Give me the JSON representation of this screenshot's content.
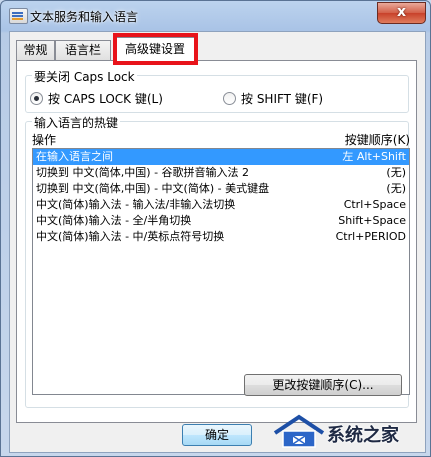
{
  "window": {
    "title": "文本服务和输入语言",
    "close_label": "x"
  },
  "tabs": [
    {
      "label": "常规"
    },
    {
      "label": "语言栏"
    },
    {
      "label": "高级键设置"
    }
  ],
  "caps_lock_group": {
    "title": "要关闭 Caps Lock",
    "options": [
      {
        "label": "按 CAPS LOCK 键(L)",
        "checked": true
      },
      {
        "label": "按 SHIFT 键(F)",
        "checked": false
      }
    ]
  },
  "hotkeys_group": {
    "title": "输入语言的热键",
    "column_action": "操作",
    "column_keys": "按键顺序(K)",
    "rows": [
      {
        "action": "在输入语言之间",
        "keys": "左 Alt+Shift",
        "selected": true
      },
      {
        "action": "切换到 中文(简体,中国) - 谷歌拼音输入法 2",
        "keys": "(无)",
        "selected": false
      },
      {
        "action": "切换到 中文(简体,中国) - 中文(简体) - 美式键盘",
        "keys": "(无)",
        "selected": false
      },
      {
        "action": "中文(简体)输入法 - 输入法/非输入法切换",
        "keys": "Ctrl+Space",
        "selected": false
      },
      {
        "action": "中文(简体)输入法 - 全/半角切换",
        "keys": "Shift+Space",
        "selected": false
      },
      {
        "action": "中文(简体)输入法 - 中/英标点符号切换",
        "keys": "Ctrl+PERIOD",
        "selected": false
      }
    ],
    "change_button": "更改按键顺序(C)..."
  },
  "footer": {
    "ok_button": "确定"
  },
  "watermark": {
    "text": "系统之家"
  },
  "colors": {
    "selection": "#3399ff",
    "highlight_box": "#e8131a",
    "close_button": "#c8412a"
  }
}
